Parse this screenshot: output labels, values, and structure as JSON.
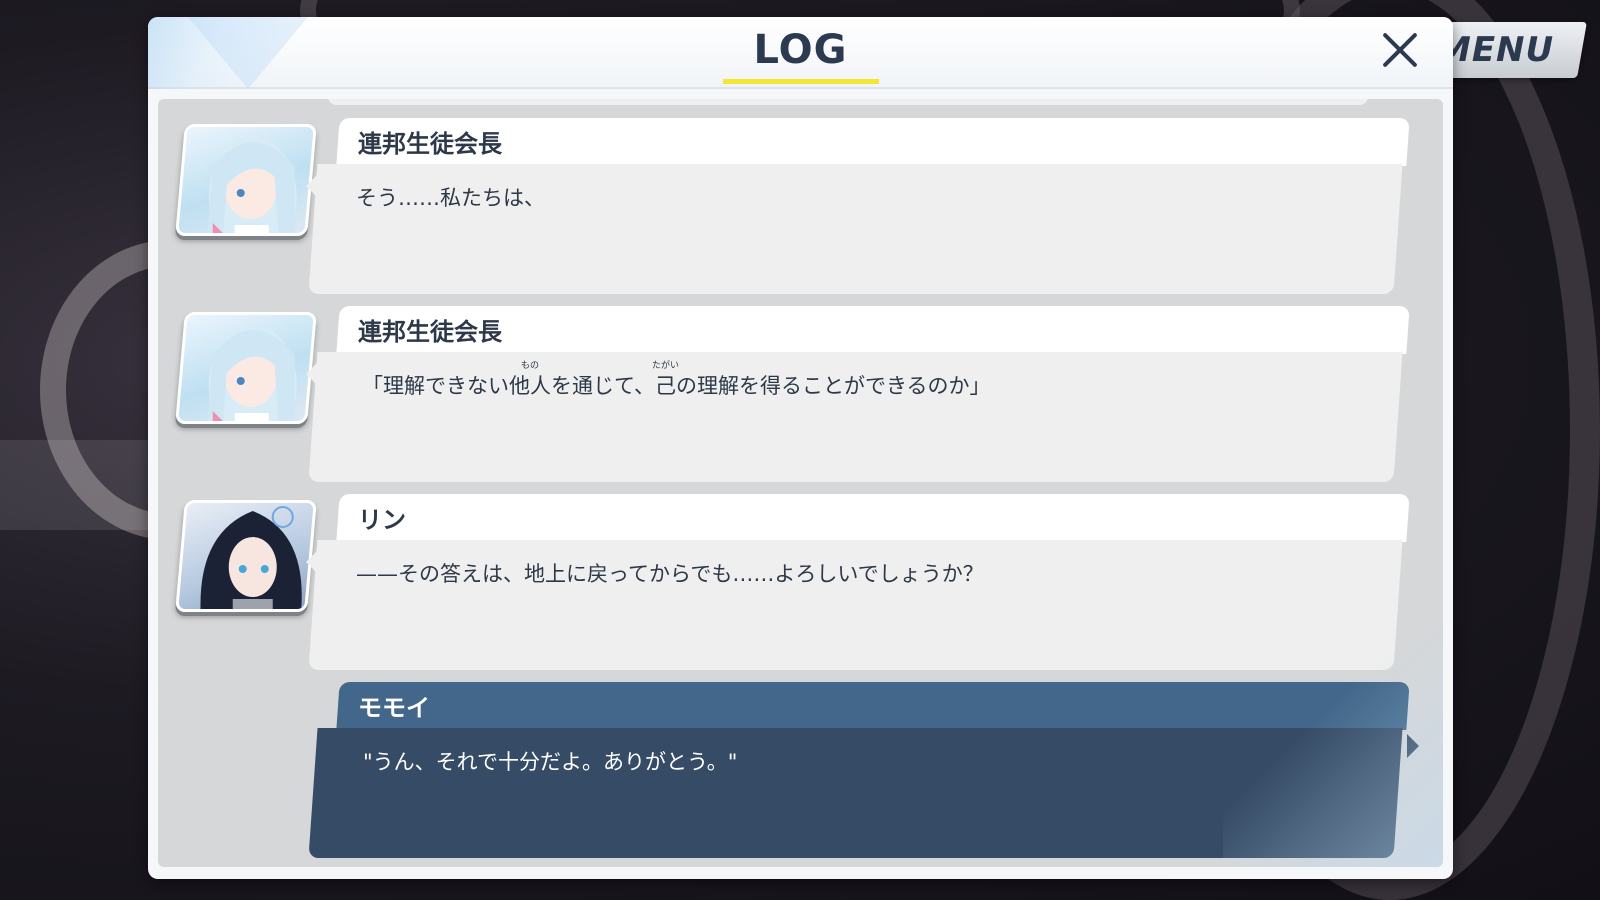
{
  "window": {
    "title": "LOG",
    "menu_label": "MENU",
    "accent_color": "#f3e733"
  },
  "entries": [
    {
      "speaker": "連邦生徒会長",
      "avatar_icon": "character-portrait-light-hair",
      "line": "そう……私たちは、"
    },
    {
      "speaker": "連邦生徒会長",
      "avatar_icon": "character-portrait-light-hair",
      "line_parts": {
        "a": "「理解できない",
        "ruby_base_1": "他人",
        "ruby_1": "もの",
        "b": "を通じて、",
        "ruby_base_2": "己",
        "ruby_2": "たがい",
        "c": "の理解を得ることができるのか」"
      }
    },
    {
      "speaker": "リン",
      "avatar_icon": "character-portrait-dark-hair",
      "line": "——その答えは、地上に戻ってからでも……よろしいでしょうか？"
    },
    {
      "speaker": "モモイ",
      "line": "\"うん、それで十分だよ。ありがとう。\"",
      "highlight_color": "#364c66"
    }
  ]
}
